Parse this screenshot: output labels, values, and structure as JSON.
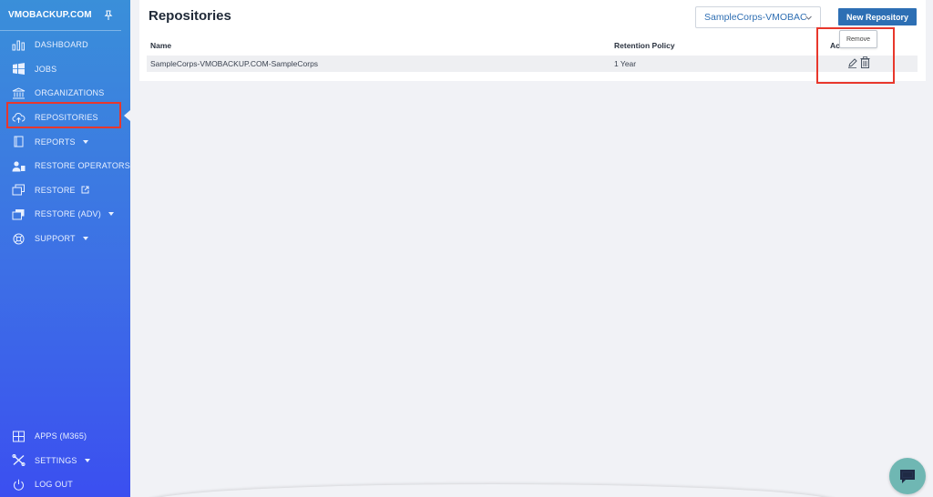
{
  "sidebar": {
    "brand": "VMOBACKUP.COM",
    "items": [
      {
        "label": "DASHBOARD",
        "icon": "bar-chart-icon"
      },
      {
        "label": "JOBS",
        "icon": "windows-icon"
      },
      {
        "label": "ORGANIZATIONS",
        "icon": "bank-icon"
      },
      {
        "label": "REPOSITORIES",
        "icon": "cloud-upload-icon",
        "active": true
      },
      {
        "label": "REPORTS",
        "icon": "book-icon",
        "dropdown": true
      },
      {
        "label": "RESTORE OPERATORS",
        "icon": "users-icon"
      },
      {
        "label": "RESTORE",
        "icon": "windows-stack-icon",
        "external": true
      },
      {
        "label": "RESTORE (ADV)",
        "icon": "windows-stack-icon",
        "dropdown": true
      },
      {
        "label": "SUPPORT",
        "icon": "lifebuoy-icon",
        "dropdown": true
      }
    ],
    "bottom_items": [
      {
        "label": "APPS (M365)",
        "icon": "grid-icon"
      },
      {
        "label": "SETTINGS",
        "icon": "tools-icon",
        "dropdown": true
      },
      {
        "label": "LOG OUT",
        "icon": "power-icon"
      }
    ]
  },
  "main": {
    "title": "Repositories",
    "org_select_value": "SampleCorps-VMOBAC",
    "new_button": "New Repository",
    "table": {
      "columns": [
        "Name",
        "Retention Policy",
        "Ac"
      ],
      "rows": [
        {
          "name": "SampleCorps-VMOBACKUP.COM-SampleCorps",
          "retention": "1 Year"
        }
      ]
    },
    "tooltip": "Remove"
  },
  "colors": {
    "sidebar_top": "#3a8fd9",
    "sidebar_bottom": "#3b4ff0",
    "primary_button": "#2d6fb4",
    "highlight": "#e8372c",
    "chat": "#6fb7b3"
  }
}
